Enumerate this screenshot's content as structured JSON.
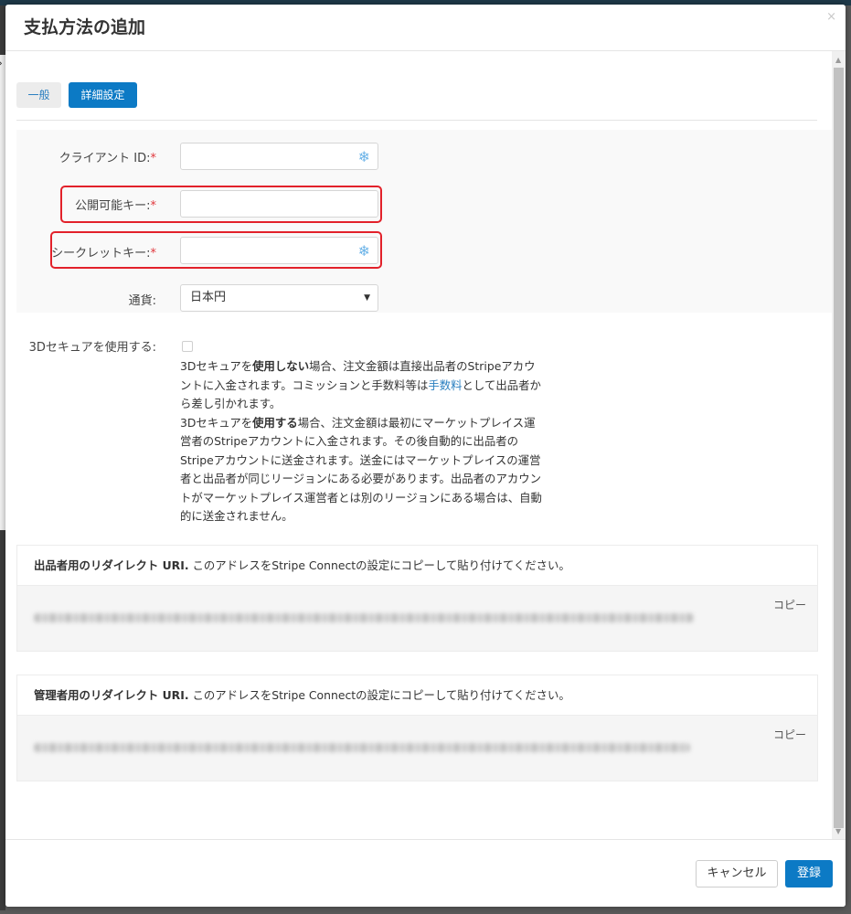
{
  "modal": {
    "title": "支払方法の追加",
    "close_symbol": "×"
  },
  "tabs": [
    {
      "label": "一般"
    },
    {
      "label": "詳細設定"
    }
  ],
  "form": {
    "client_id": {
      "label": "クライアント ID:",
      "required": "*",
      "value": ""
    },
    "publishable_key": {
      "label": "公開可能キー:",
      "required": "*",
      "value": ""
    },
    "secret_key": {
      "label": "シークレットキー:",
      "required": "*",
      "value": ""
    },
    "currency": {
      "label": "通貨:",
      "value": "日本円"
    },
    "secure3d": {
      "label": "3Dセキュアを使用する:",
      "checked": false,
      "desc": {
        "p1_a": "3Dセキュアを",
        "p1_b": "使用しない",
        "p1_c": "場合、注文金額は直接出品者のStripeアカウントに入金されます。コミッションと手数料等は",
        "p1_link": "手数料",
        "p1_d": "として出品者から差し引かれます。",
        "p2_a": "3Dセキュアを",
        "p2_b": "使用する",
        "p2_c": "場合、注文金額は最初にマーケットプレイス運営者のStripeアカウントに入金されます。その後自動的に出品者のStripeアカウントに送金されます。送金にはマーケットプレイスの運営者と出品者が同じリージョンにある必要があります。出品者のアカウントがマーケットプレイス運営者とは別のリージョンにある場合は、自動的に送金されません。"
      }
    }
  },
  "redirect_vendor": {
    "title": "出品者用のリダイレクト URI.",
    "text": " このアドレスをStripe Connectの設定にコピーして貼り付けてください。",
    "copy_label": "コピー"
  },
  "redirect_admin": {
    "title": "管理者用のリダイレクト URI.",
    "text": " このアドレスをStripe Connectの設定にコピーして貼り付けてください。",
    "copy_label": "コピー"
  },
  "footer": {
    "cancel_label": "キャンセル",
    "save_label": "登録"
  },
  "colors": {
    "primary": "#0c7ac5",
    "required": "#e0383d",
    "highlight": "#e2212a",
    "link": "#2a7fc0"
  }
}
